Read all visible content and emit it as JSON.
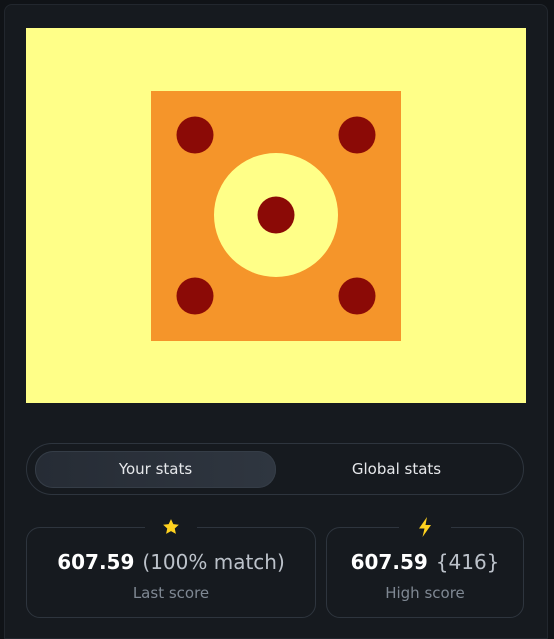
{
  "game": {
    "colors": {
      "background": "#ffff88",
      "square": "#f5952a",
      "circle": "#ffff88",
      "dots": "#8b0a06"
    }
  },
  "tabs": {
    "your_stats": "Your stats",
    "global_stats": "Global stats"
  },
  "stats": {
    "last": {
      "icon": "star-icon",
      "score": "607.59",
      "detail": "(100% match)",
      "label": "Last score"
    },
    "high": {
      "icon": "lightning-icon",
      "score": "607.59",
      "detail": "{416}",
      "label": "High score"
    }
  }
}
